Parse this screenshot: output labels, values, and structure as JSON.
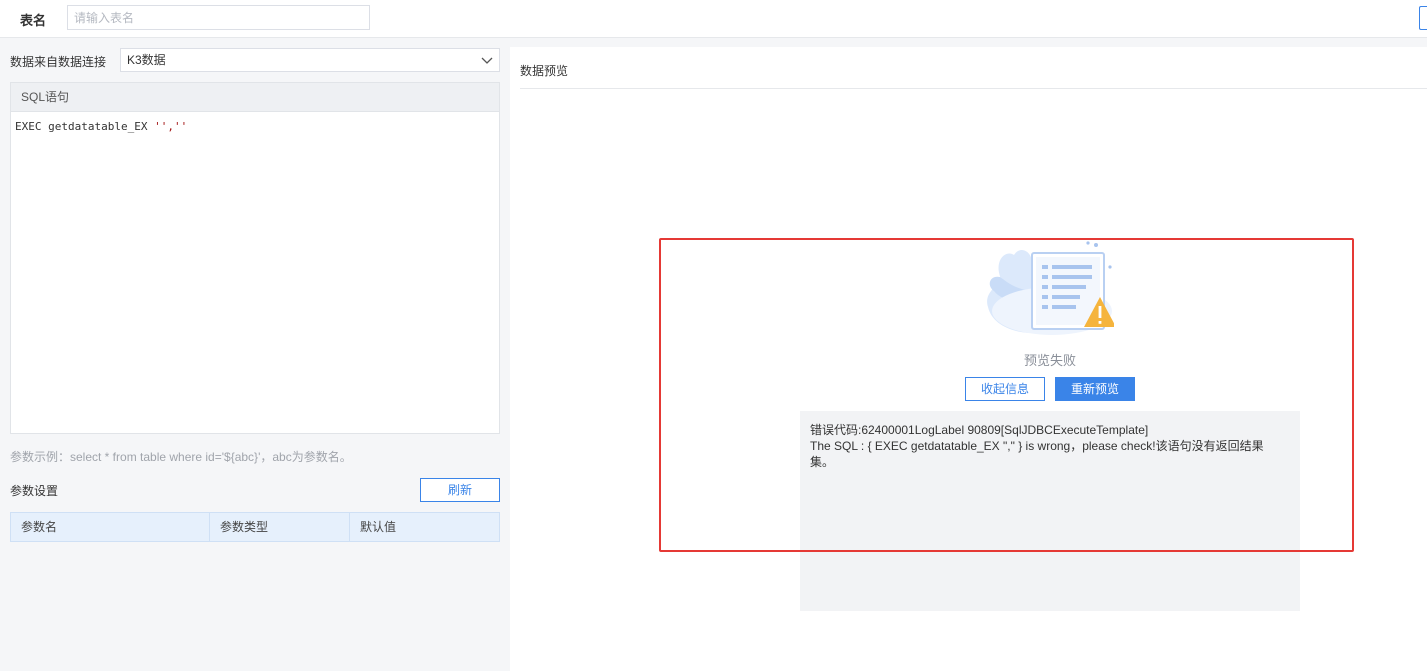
{
  "header": {
    "table_name_label": "表名",
    "table_name_placeholder": "请输入表名"
  },
  "connection": {
    "label": "数据来自数据连接",
    "selected": "K3数据"
  },
  "sql": {
    "header": "SQL语句",
    "code_prefix": "EXEC getdatatable_EX ",
    "code_args": "'',''"
  },
  "params": {
    "hint": "参数示例：select * from table where id='${abc}'，abc为参数名。",
    "settings_label": "参数设置",
    "refresh_label": "刷新",
    "columns": [
      "参数名",
      "参数类型",
      "默认值"
    ]
  },
  "preview": {
    "title": "数据预览",
    "status": "预览失败",
    "collapse_label": "收起信息",
    "retry_label": "重新预览",
    "error_line1": "错误代码:62400001LogLabel 90809[SqlJDBCExecuteTemplate]",
    "error_line2": "The SQL : {  EXEC getdatatable_EX \",\"  } is wrong，please check!该语句没有返回结果",
    "error_line3": "集。"
  },
  "colors": {
    "accent": "#3a84e8",
    "highlight": "#e53935"
  }
}
